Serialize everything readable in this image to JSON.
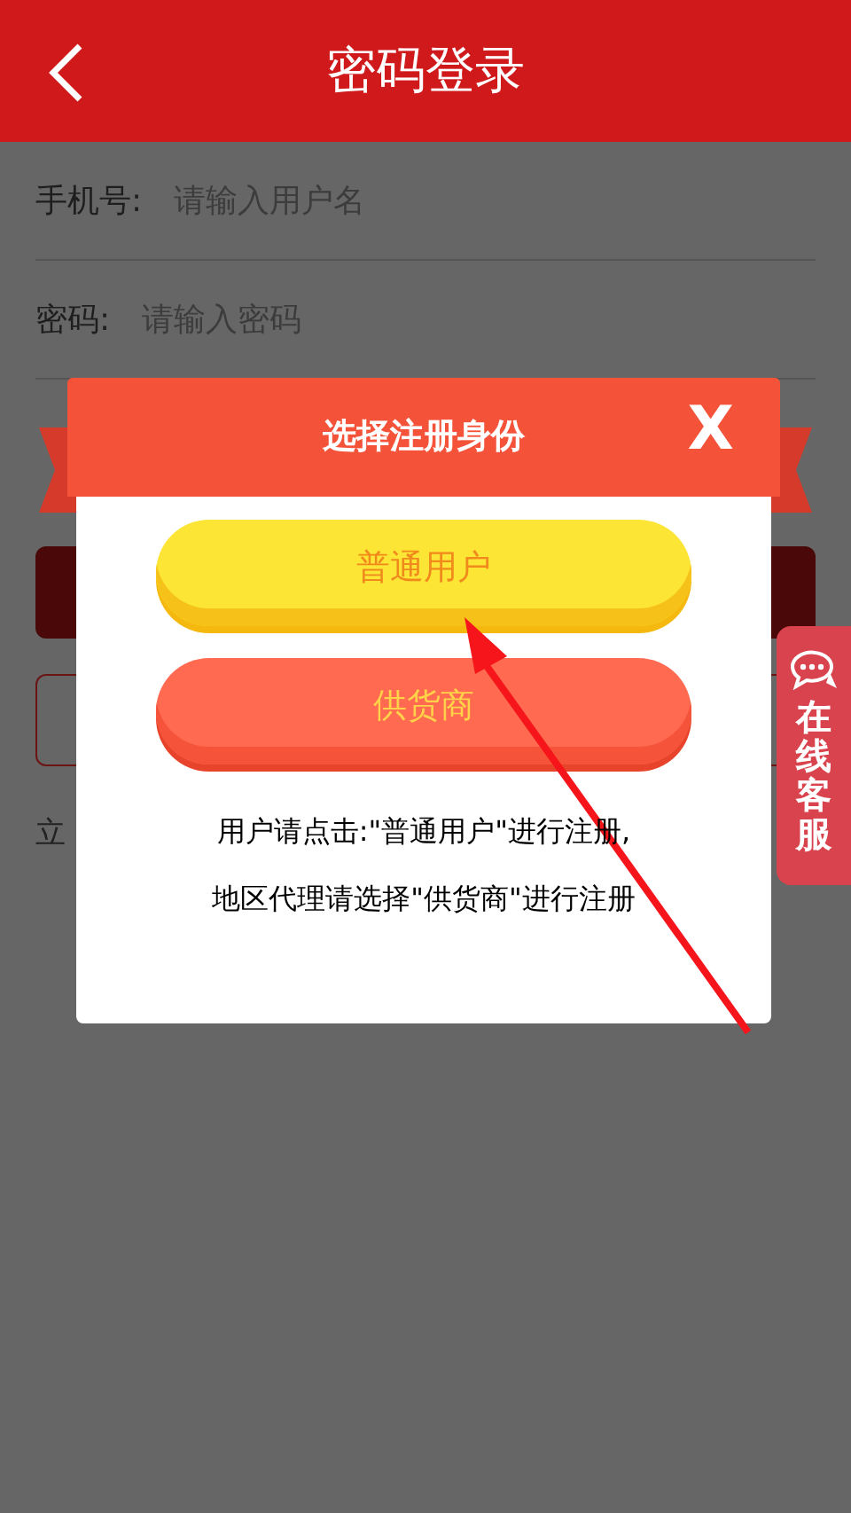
{
  "header": {
    "title": "密码登录"
  },
  "form": {
    "fields": [
      {
        "label": "手机号:",
        "placeholder": "请输入用户名"
      },
      {
        "label": "密码:",
        "placeholder": "请输入密码"
      }
    ],
    "footer_text": "立"
  },
  "side_tab": {
    "label": "在线客服"
  },
  "dialog": {
    "title": "选择注册身份",
    "close": "X",
    "options": [
      {
        "label": "普通用户",
        "kind": "yellow"
      },
      {
        "label": "供货商",
        "kind": "red"
      }
    ],
    "lines": [
      "用户请点击:\"普通用户\"进行注册,",
      "地区代理请选择\"供货商\"进行注册"
    ]
  }
}
